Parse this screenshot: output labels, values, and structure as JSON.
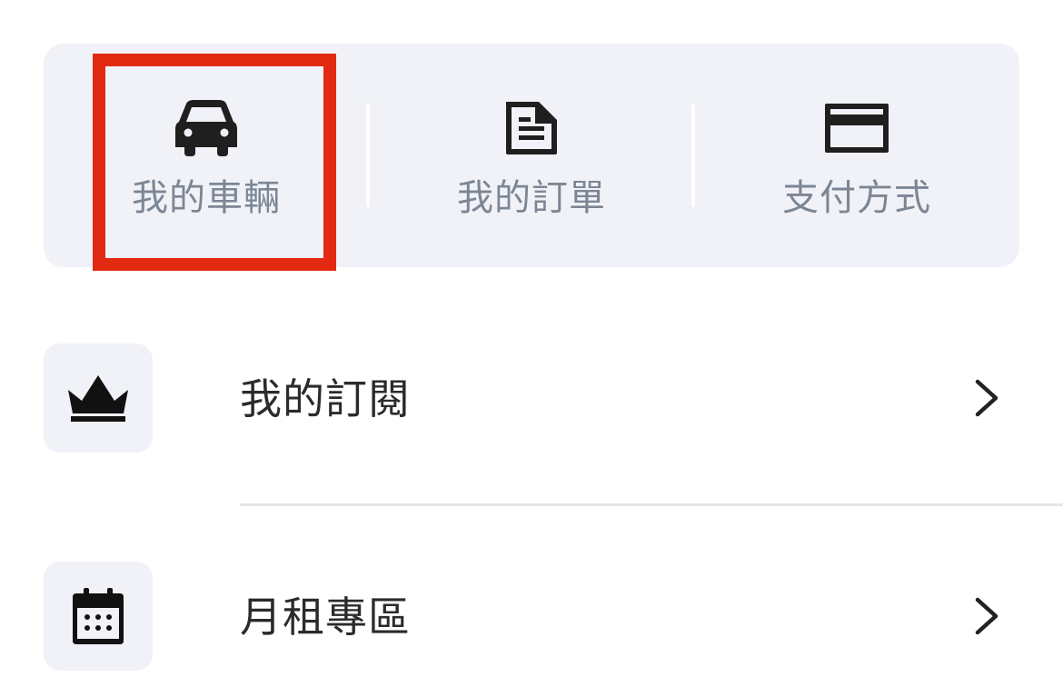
{
  "quick_actions": [
    {
      "label": "我的車輛",
      "icon": "car-icon"
    },
    {
      "label": "我的訂單",
      "icon": "document-icon"
    },
    {
      "label": "支付方式",
      "icon": "credit-card-icon"
    }
  ],
  "menu": [
    {
      "label": "我的訂閱",
      "icon": "crown-icon",
      "trailing_icon": "chevron-right-icon"
    },
    {
      "label": "月租專區",
      "icon": "calendar-icon",
      "trailing_icon": "chevron-right-icon"
    }
  ],
  "colors": {
    "panel_bg": "#f0f2f7",
    "quick_label": "#7d8694",
    "menu_label": "#2b2b2b",
    "highlight": "#e22a12",
    "icon": "#1f1f1f"
  }
}
